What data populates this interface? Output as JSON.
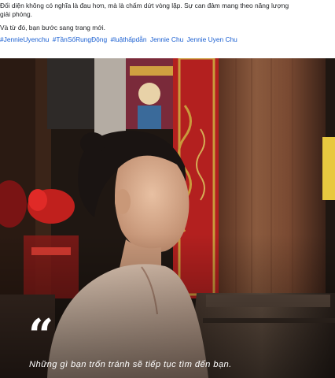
{
  "post": {
    "caption_lines": [
      "Đối diện không có nghĩa là đau hơn, mà là chấm dứt vòng lặp. Sự can đảm mang theo năng lượng",
      "giải phóng.",
      "Và từ đó, bạn bước sang trang mới."
    ],
    "hashtags": [
      "#JennieUyenchu",
      "#TầnSốRungĐộng",
      "#luậthấpdẫn",
      "Jennie Chu",
      "Jennie Uyen Chu"
    ]
  },
  "image": {
    "quote_mark": "“",
    "quote_text": "Những gì bạn trốn tránh sẽ tiếp tục tìm đến bạn.",
    "colors": {
      "pillar_wood": "#7a4a32",
      "red_panel": "#b3201f",
      "gold_trim": "#c99a3c",
      "background_dark": "#1f1712"
    }
  }
}
